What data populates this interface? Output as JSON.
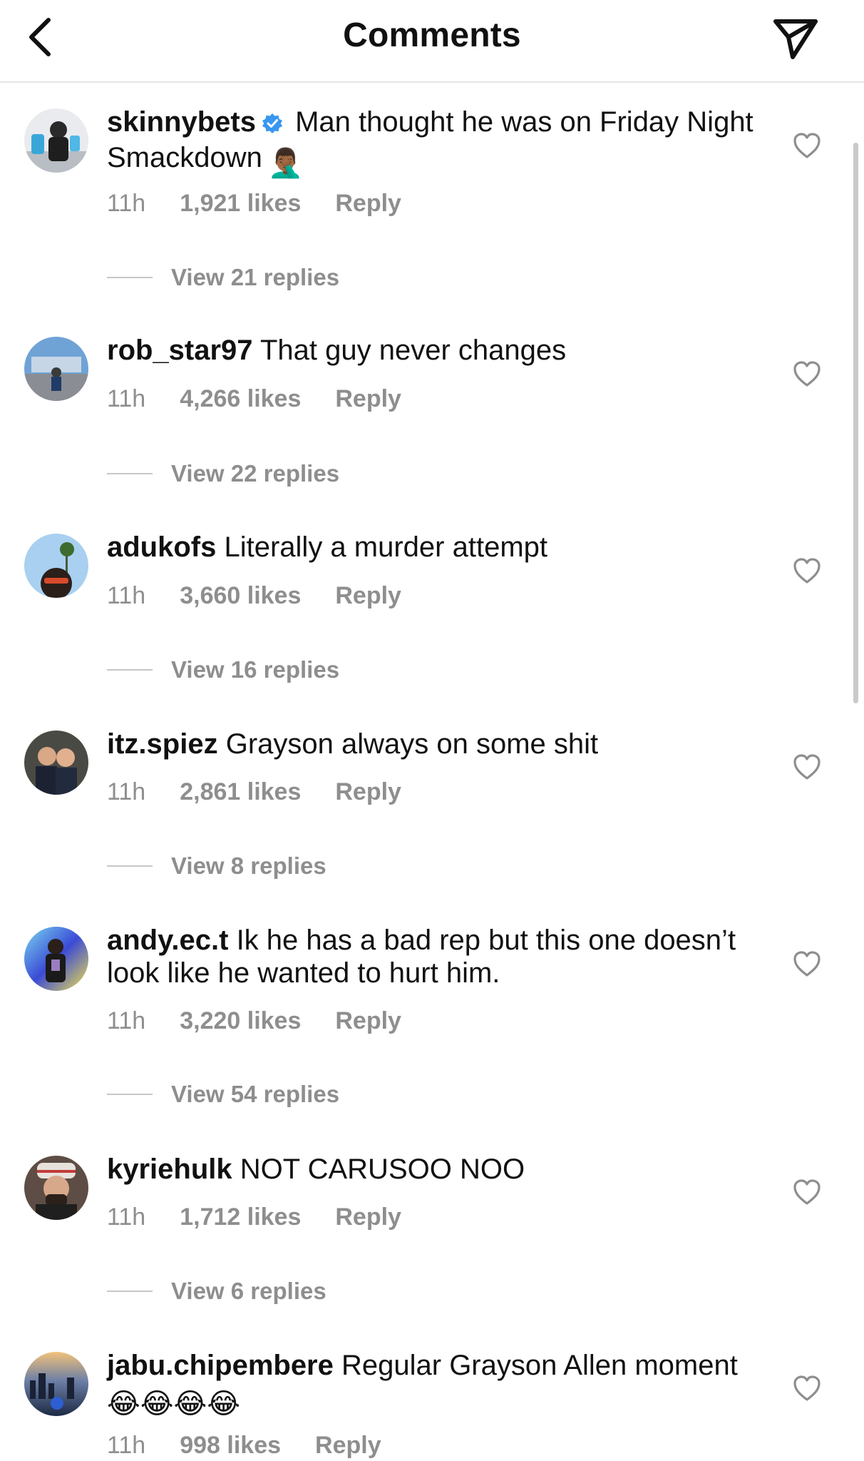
{
  "header": {
    "title": "Comments",
    "back_icon": "chevron-left-icon",
    "share_icon": "paper-plane-icon"
  },
  "colors": {
    "text": "#111111",
    "muted": "#8e8e8e",
    "verified": "#3897f0",
    "divider": "#e6e6e6"
  },
  "comments": [
    {
      "username": "skinnybets",
      "verified": true,
      "text": "Man thought he was on Friday Night Smackdown",
      "emoji": "🤦🏾‍♂️",
      "time": "11h",
      "likes": "1,921 likes",
      "reply": "Reply",
      "view_replies": "View 21 replies"
    },
    {
      "username": "rob_star97",
      "verified": false,
      "text": "That guy never changes",
      "time": "11h",
      "likes": "4,266 likes",
      "reply": "Reply",
      "view_replies": "View 22 replies"
    },
    {
      "username": "adukofs",
      "verified": false,
      "text": "Literally a murder attempt",
      "time": "11h",
      "likes": "3,660 likes",
      "reply": "Reply",
      "view_replies": "View 16 replies"
    },
    {
      "username": "itz.spiez",
      "verified": false,
      "text": "Grayson always on some shit",
      "time": "11h",
      "likes": "2,861 likes",
      "reply": "Reply",
      "view_replies": "View 8 replies"
    },
    {
      "username": "andy.ec.t",
      "verified": false,
      "text": "Ik he has a bad rep but this one doesn’t look like he wanted to hurt him.",
      "time": "11h",
      "likes": "3,220 likes",
      "reply": "Reply",
      "view_replies": "View 54 replies"
    },
    {
      "username": "kyriehulk",
      "verified": false,
      "text": "NOT CARUSOO NOO",
      "time": "11h",
      "likes": "1,712 likes",
      "reply": "Reply",
      "view_replies": "View 6 replies"
    },
    {
      "username": "jabu.chipembere",
      "verified": false,
      "text": "Regular Grayson Allen moment",
      "emoji": "😂😂😂😂",
      "time": "11h",
      "likes": "998 likes",
      "reply": "Reply"
    }
  ]
}
